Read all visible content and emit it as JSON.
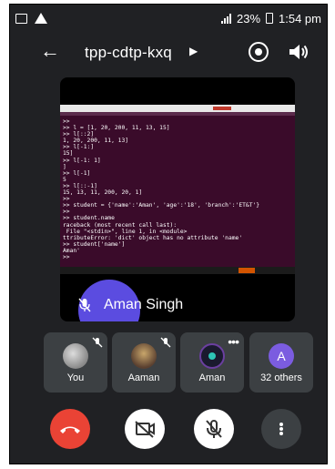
{
  "status_bar": {
    "battery": "23%",
    "time": "1:54 pm"
  },
  "top_bar": {
    "meeting_code": "tpp-cdtp-kxq"
  },
  "main_tile": {
    "participant_name": "Aman Singh",
    "terminal_lines": [
      ">>",
      ">> l = [1, 20, 200, 11, 13, 15]",
      ">> l[::2]",
      "1, 20, 200, 11, 13]",
      ">> l[-1:]",
      "15]",
      ">> l[-1: 1]",
      "]",
      ">> l[-1]",
      "5",
      ">> l[::-1]",
      "15, 13, 11, 200, 20, 1]",
      ">>",
      ">> student = {'name':'Aman', 'age':'18', 'branch':'ET&T'}",
      ">>",
      ">> student.name",
      "raceback (most recent call last):",
      " File \"<stdin>\", line 1, in <module>",
      "ttributeError: 'dict' object has no attribute 'name'",
      ">> student['name']",
      "Aman'",
      ">>"
    ]
  },
  "participants": [
    {
      "name": "You",
      "muted": true
    },
    {
      "name": "Aaman",
      "muted": true
    },
    {
      "name": "Aman",
      "more": true
    },
    {
      "name": "32 others",
      "initial": "A"
    }
  ],
  "colors": {
    "background": "#202124",
    "tile": "#3c4043",
    "end_call": "#ea4335",
    "terminal": "#3a0b2a"
  }
}
